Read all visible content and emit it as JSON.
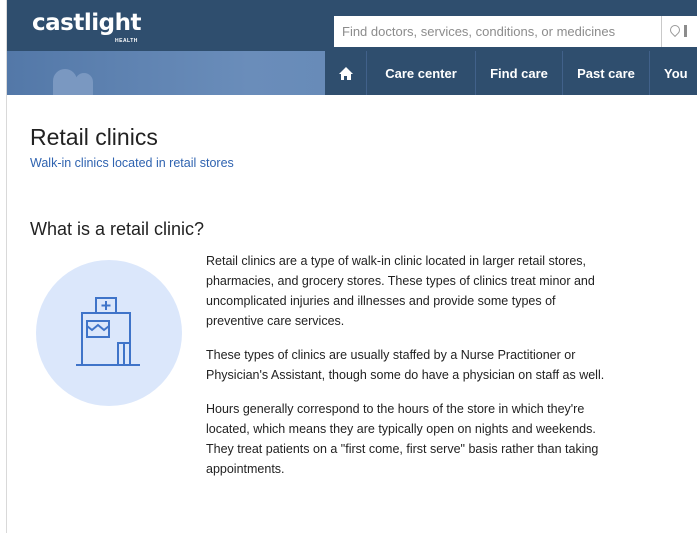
{
  "header": {
    "logo_text": "castlight",
    "logo_subtext": "HEALTH",
    "search": {
      "placeholder": "Find doctors, services, conditions, or medicines",
      "value": ""
    },
    "location_icon": "location-pin-icon"
  },
  "nav": {
    "home_icon": "home-icon",
    "items": [
      {
        "label": "Care center"
      },
      {
        "label": "Find care"
      },
      {
        "label": "Past care"
      },
      {
        "label": "You"
      }
    ]
  },
  "page": {
    "title": "Retail clinics",
    "subtitle": "Walk-in clinics located in retail stores",
    "section": {
      "heading": "What is a retail clinic?",
      "illustration_icon": "retail-clinic-store-icon",
      "paragraphs": [
        "Retail clinics are a type of walk-in clinic located in larger retail stores, pharmacies, and grocery stores. These types of clinics treat minor and uncomplicated injuries and illnesses and provide some types of preventive care services.",
        "These types of clinics are usually staffed by a Nurse Practitioner or Physician's Assistant, though some do have a physician on staff as well.",
        "Hours generally correspond to the hours of the store in which they're located, which means they are typically open on nights and weekends. They treat patients on a \"first come, first serve\" basis rather than taking appointments."
      ]
    }
  },
  "colors": {
    "header_bg": "#2f4e6e",
    "nav_band": "#5d81b0",
    "link": "#2f63b0",
    "illustration_bg": "#dbe7fb",
    "illustration_stroke": "#3f74c9"
  }
}
